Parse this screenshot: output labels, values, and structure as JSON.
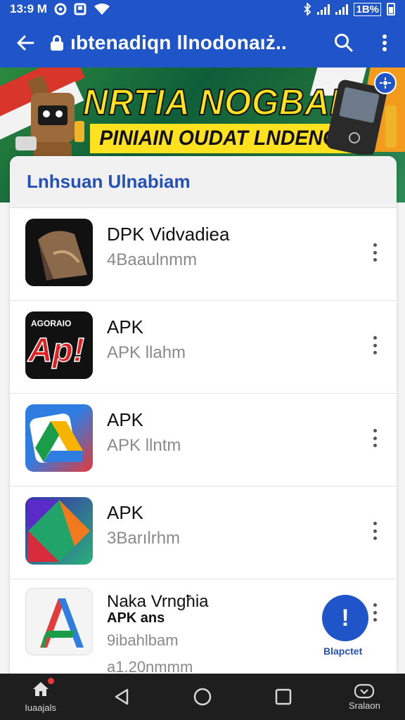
{
  "status_bar": {
    "time": "13:9 M",
    "battery_text": "1B%"
  },
  "app_bar": {
    "title": "ıbtenadiqn llnodonaıż..",
    "icons": [
      "back-arrow-icon",
      "lock-icon",
      "search-icon",
      "more-vert-icon"
    ]
  },
  "banner": {
    "headline": "NRTIA NOGBAR!",
    "subline": "PINIAIN OUDAT LNDENGH",
    "colors": {
      "headline": "#ffe21f",
      "background": "#1c6b3a"
    }
  },
  "card": {
    "title": "Lnhsuan Ulnabiam",
    "apps": [
      {
        "name": "DPK Vidvadiea",
        "desc": "4Baaulnmm",
        "icon": "app-icon-dark-hat"
      },
      {
        "name": "APK",
        "desc": "APK llahm",
        "icon": "app-icon-red-ap",
        "icon_text_top": "AGORAIO",
        "icon_text_main": "Ap!"
      },
      {
        "name": "APK",
        "desc": "APK llntm",
        "icon": "app-icon-drive-multicolor"
      },
      {
        "name": "APK",
        "desc": "3Barılrhm",
        "icon": "app-icon-triangle-multicolor"
      },
      {
        "name": "Naka Vrngħia",
        "name2": "APK ans",
        "desc": "9ibahlbam",
        "desc2": "a1.20nmmm",
        "icon": "app-icon-letter-a"
      }
    ]
  },
  "fab": {
    "symbol": "!",
    "label": "Blapctet"
  },
  "bottom_nav": {
    "items": [
      {
        "label": "Iuaajals",
        "icon": "home-icon"
      },
      {
        "label": "",
        "icon": "back-triangle-icon"
      },
      {
        "label": "",
        "icon": "home-circle-icon"
      },
      {
        "label": "",
        "icon": "recents-square-icon"
      },
      {
        "label": "Sralaon",
        "icon": "gamepad-icon"
      }
    ]
  },
  "colors": {
    "primary": "#1f55c8",
    "nav_bg": "#1e1e1e",
    "card_title": "#2451b8"
  }
}
